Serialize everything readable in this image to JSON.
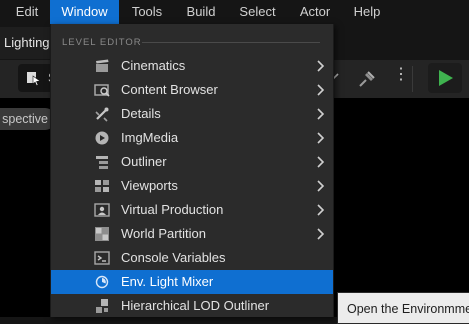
{
  "menubar": {
    "items": [
      {
        "label": "Edit"
      },
      {
        "label": "Window"
      },
      {
        "label": "Tools"
      },
      {
        "label": "Build"
      },
      {
        "label": "Select"
      },
      {
        "label": "Actor"
      },
      {
        "label": "Help"
      }
    ],
    "active_index": 1
  },
  "tab": {
    "label": "Lighting."
  },
  "toolbar": {
    "select_partial": "S",
    "more_icon": "more-vertical-icon",
    "snap_icon": "snap-icon",
    "play_icon": "play-icon",
    "colors": {
      "play": "#3fb34f"
    }
  },
  "viewport": {
    "perspective_label": "spective"
  },
  "window_menu": {
    "section_header": "LEVEL EDITOR",
    "items": [
      {
        "label": "Cinematics",
        "icon": "clapperboard-icon",
        "submenu": true
      },
      {
        "label": "Content Browser",
        "icon": "content-browser-icon",
        "submenu": true
      },
      {
        "label": "Details",
        "icon": "details-icon",
        "submenu": true
      },
      {
        "label": "ImgMedia",
        "icon": "media-icon",
        "submenu": true
      },
      {
        "label": "Outliner",
        "icon": "outliner-icon",
        "submenu": true
      },
      {
        "label": "Viewports",
        "icon": "viewports-icon",
        "submenu": true
      },
      {
        "label": "Virtual Production",
        "icon": "virtual-production-icon",
        "submenu": true
      },
      {
        "label": "World Partition",
        "icon": "world-partition-icon",
        "submenu": true
      },
      {
        "label": "Console Variables",
        "icon": "console-variables-icon",
        "submenu": false
      },
      {
        "label": "Env. Light Mixer",
        "icon": "light-mixer-icon",
        "submenu": false
      },
      {
        "label": "Hierarchical LOD Outliner",
        "icon": "hlod-icon",
        "submenu": false
      }
    ],
    "highlighted_index": 9
  },
  "tooltip": {
    "text": "Open the Environmment"
  },
  "colors": {
    "menu_highlight": "#0f6fd1",
    "menu_background": "#2b2b2b"
  }
}
